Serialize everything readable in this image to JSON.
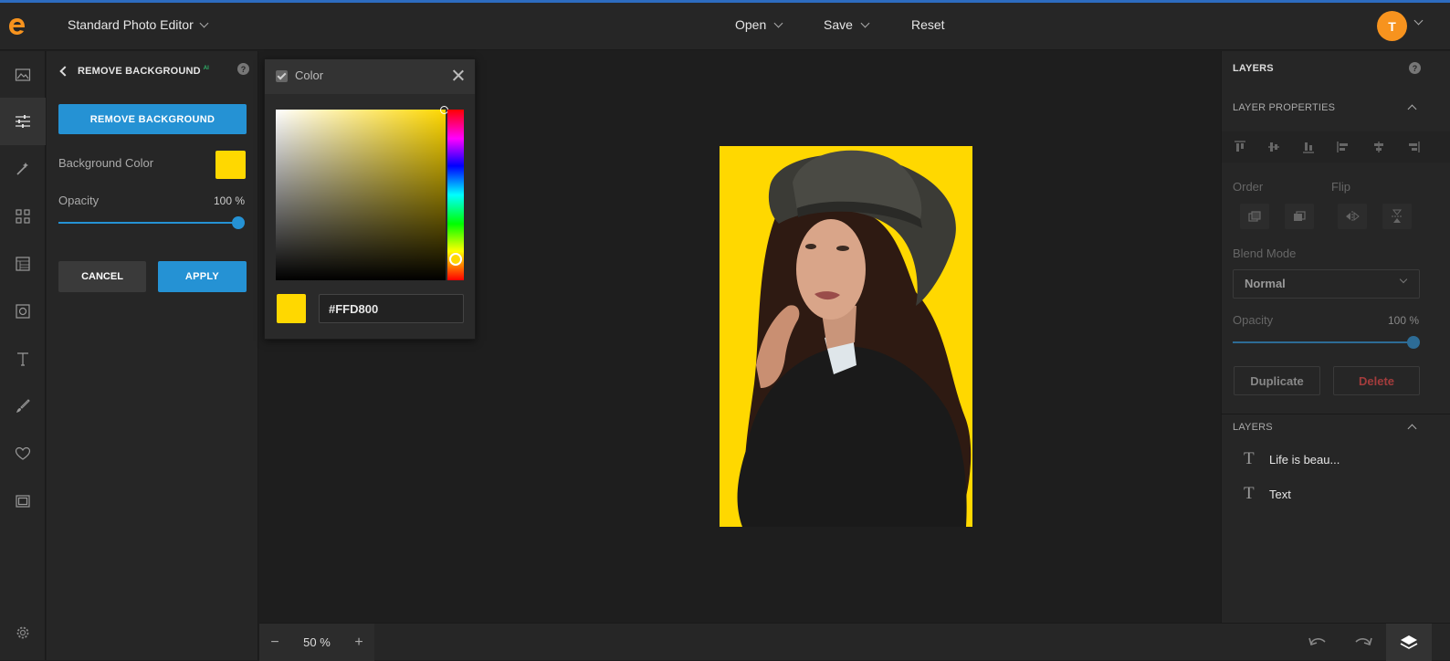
{
  "app": {
    "title": "Standard Photo Editor",
    "menu": {
      "open": "Open",
      "save": "Save",
      "reset": "Reset"
    },
    "avatar_initial": "T",
    "brand_color": "#f7931e",
    "accent_color": "#2592d4"
  },
  "toolstrip": {
    "items": [
      "image-icon",
      "adjust-sliders-icon",
      "magic-wand-icon",
      "grid-icon",
      "texture-icon",
      "frame-icon",
      "text-icon",
      "brush-icon",
      "heart-icon",
      "border-icon",
      "settings-icon"
    ],
    "active": "adjust-sliders-icon"
  },
  "left_panel": {
    "title": "REMOVE BACKGROUND",
    "ai_badge": "AI",
    "remove_button": "REMOVE BACKGROUND",
    "bg_color_label": "Background Color",
    "bg_color": "#ffd800",
    "opacity_label": "Opacity",
    "opacity_value": "100 %",
    "opacity": 1.0,
    "cancel": "CANCEL",
    "apply": "APPLY"
  },
  "color_picker": {
    "title": "Color",
    "hex": "#FFD800",
    "color": "#ffd800"
  },
  "right_panel": {
    "title": "LAYERS",
    "layer_properties": "LAYER PROPERTIES",
    "order_label": "Order",
    "flip_label": "Flip",
    "blend_mode_label": "Blend Mode",
    "blend_mode": "Normal",
    "opacity_label": "Opacity",
    "opacity_value": "100 %",
    "duplicate": "Duplicate",
    "delete": "Delete",
    "layers_section": "LAYERS",
    "layers": [
      {
        "name": "Life is beau..."
      },
      {
        "name": "Text"
      }
    ]
  },
  "bottom": {
    "zoom_minus": "−",
    "zoom_value": "50 %",
    "zoom_plus": "+"
  }
}
